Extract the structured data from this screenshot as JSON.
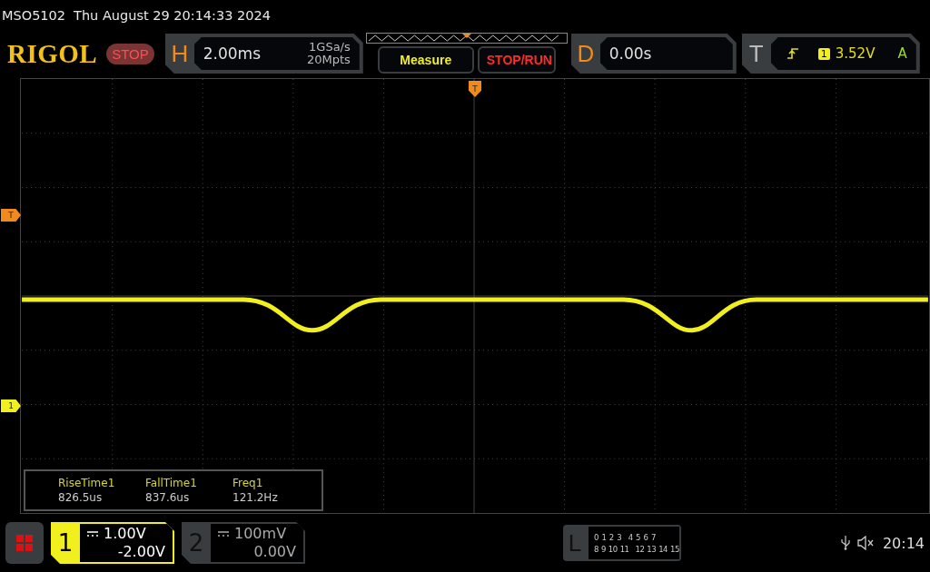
{
  "header": {
    "model": "MSO5102",
    "datetime": "Thu August 29 20:14:33 2024"
  },
  "logo": "RIGOL",
  "run_state": {
    "label": "STOP",
    "kind": "stop"
  },
  "horizontal": {
    "letter": "H",
    "timebase": "2.00ms",
    "sample_rate": "1GSa/s",
    "memory_depth": "20Mpts"
  },
  "buttons": [
    {
      "label": "Measure",
      "kind": "measure"
    },
    {
      "label": "STOP/RUN",
      "kind": "stoprun"
    }
  ],
  "delay": {
    "letter": "D",
    "value": "0.00s"
  },
  "trigger": {
    "letter": "T",
    "source": "1",
    "level": "3.52V",
    "mode": "A"
  },
  "markers": [
    {
      "label": "T",
      "kind": "top",
      "color": "#f08a1c"
    },
    {
      "label": "T",
      "kind": "left_upper",
      "color": "#f08a1c"
    },
    {
      "label": "1",
      "kind": "left_lower",
      "color": "#f2ef1e"
    }
  ],
  "measurements": [
    {
      "name": "RiseTime1",
      "value": "826.5us"
    },
    {
      "name": "FallTime1",
      "value": "837.6us"
    },
    {
      "name": "Freq1",
      "value": "121.2Hz"
    }
  ],
  "channels": [
    {
      "number": "1",
      "scale": "1.00V",
      "offset": "-2.00V",
      "selected": true
    },
    {
      "number": "2",
      "scale": "100mV",
      "offset": "0.00V",
      "selected": false
    }
  ],
  "logic": {
    "letter": "L",
    "row_1": [
      "0",
      "1",
      "2",
      "3",
      "4",
      "5",
      "6",
      "7"
    ],
    "row_2": [
      "8",
      "9",
      "10",
      "11",
      "12",
      "13",
      "14",
      "15"
    ]
  },
  "status": {
    "time": "20:14"
  }
}
